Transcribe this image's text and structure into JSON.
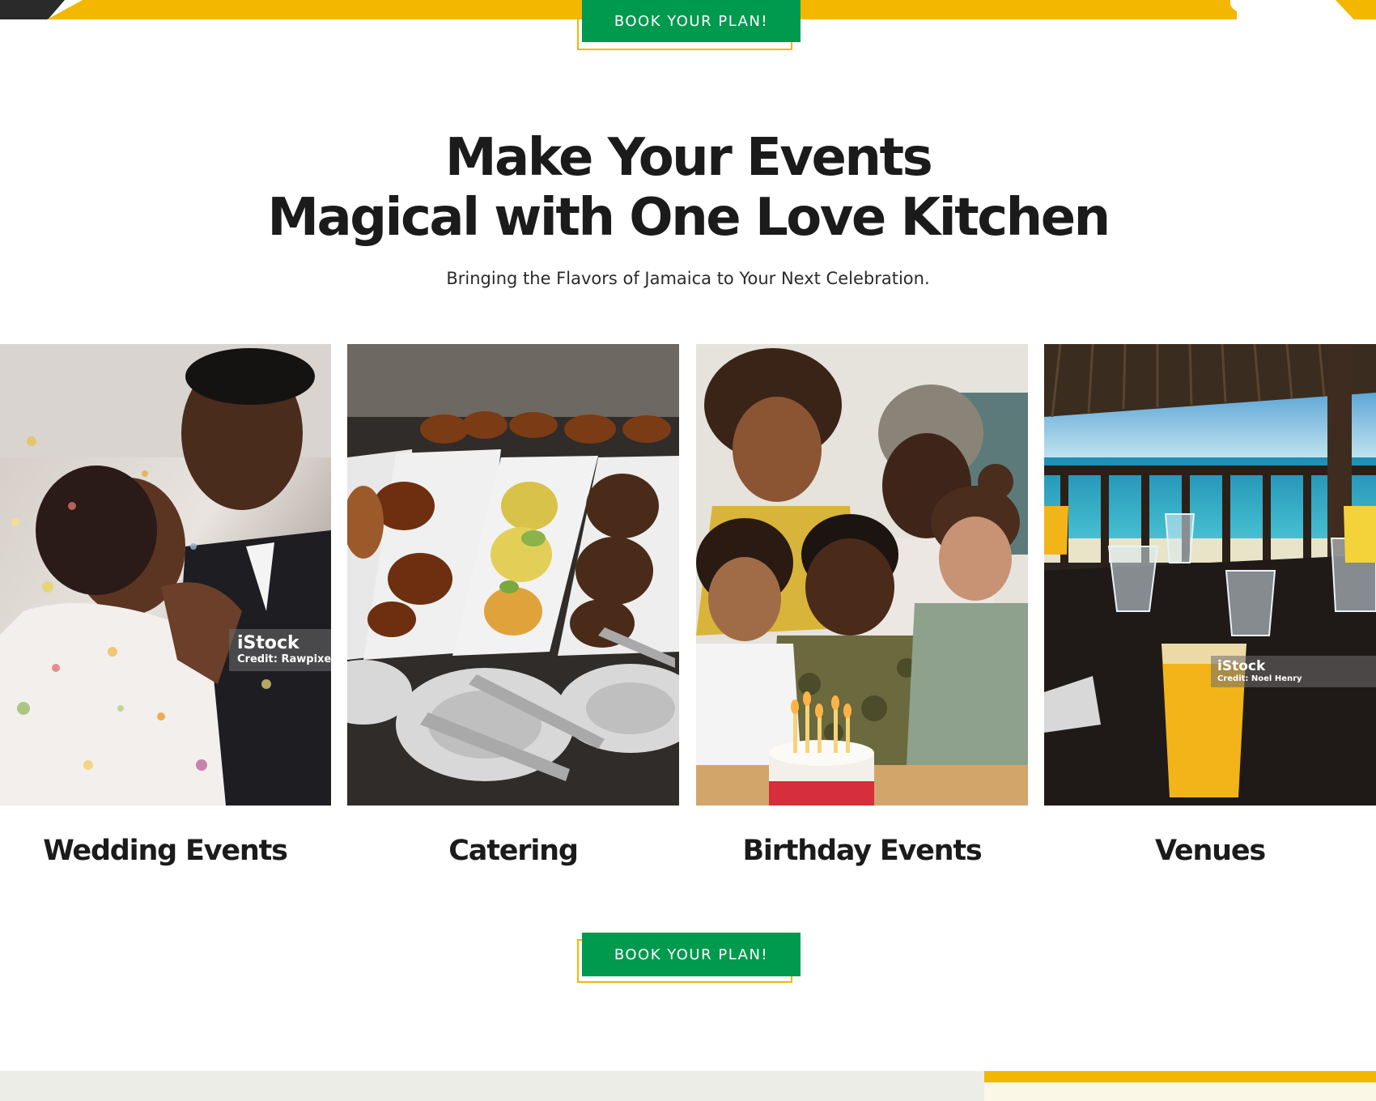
{
  "colors": {
    "brand_green": "#009a4e",
    "brand_yellow": "#f4b700",
    "text_dark": "#1b1b1b",
    "band_dark": "#2a2a2a",
    "footer_grey": "#ecede7"
  },
  "cta": {
    "top_label": "BOOK YOUR PLAN!",
    "bottom_label": "BOOK YOUR PLAN!"
  },
  "hero": {
    "title_line1": "Make Your Events",
    "title_line2": "Magical with One Love Kitchen",
    "subtitle": "Bringing the Flavors of Jamaica to Your Next Celebration."
  },
  "events": [
    {
      "title": "Wedding Events",
      "image_icon": "wedding-couple-photo",
      "watermark_brand": "iStock",
      "watermark_credit": "Credit: Rawpixel"
    },
    {
      "title": "Catering",
      "image_icon": "buffet-food-photo"
    },
    {
      "title": "Birthday Events",
      "image_icon": "birthday-family-photo"
    },
    {
      "title": "Venues",
      "image_icon": "beach-venue-photo",
      "watermark_brand": "iStock",
      "watermark_credit": "Credit: Noel Henry"
    }
  ]
}
